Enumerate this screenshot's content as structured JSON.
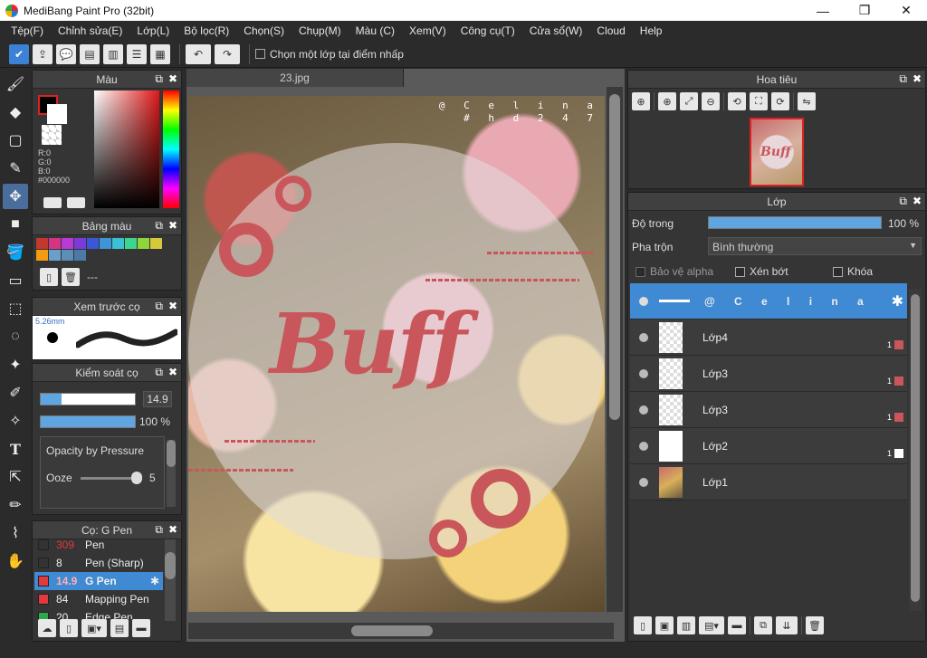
{
  "window": {
    "title": "MediBang Paint Pro (32bit)",
    "minimize": "—",
    "maximize": "❐",
    "close": "✕"
  },
  "menu": [
    "Tệp(F)",
    "Chỉnh sửa(E)",
    "Lớp(L)",
    "Bộ lọc(R)",
    "Chọn(S)",
    "Chụp(M)",
    "Màu (C)",
    "Xem(V)",
    "Công cụ(T)",
    "Cửa sổ(W)",
    "Cloud",
    "Help"
  ],
  "toolbar": {
    "select_one_layer_label": "Chọn một lớp tại điểm nhấp"
  },
  "color_panel": {
    "title": "Màu",
    "r": "R:0",
    "g": "G:0",
    "b": "B:0",
    "hex": "#000000"
  },
  "palette_panel": {
    "title": "Bảng màu",
    "name": "---",
    "swatches": [
      "#c0392b",
      "#d63384",
      "#b83bd6",
      "#7a3bd6",
      "#3b56d6",
      "#3b95d6",
      "#3bc0d6",
      "#3bd68f",
      "#8fd63b",
      "#d6c83b",
      "#f39c12",
      "#6aa0c8",
      "#5c8fb8",
      "#4a7aa5"
    ]
  },
  "brush_preview": {
    "title": "Xem trước cọ",
    "size": "5.26mm"
  },
  "brush_control": {
    "title": "Kiểm soát cọ",
    "size_value": "14.9",
    "opacity_value": "100 %",
    "size_fraction": 0.22,
    "opacity_fraction": 1.0,
    "pressure_label": "Opacity by Pressure",
    "ooze_label": "Ooze",
    "ooze_value": "5"
  },
  "brush_list": {
    "title": "Cọ: G Pen",
    "items": [
      {
        "size": "309",
        "name": "Pen",
        "color": "#333333"
      },
      {
        "size": "8",
        "name": "Pen (Sharp)",
        "color": "#333333"
      },
      {
        "size": "14.9",
        "name": "G Pen",
        "color": "#e0393e",
        "selected": true
      },
      {
        "size": "84",
        "name": "Mapping Pen",
        "color": "#e0393e"
      },
      {
        "size": "20",
        "name": "Edge Pen",
        "color": "#2ba84a"
      }
    ]
  },
  "document": {
    "tab": "23.jpg",
    "signature": "@ C e l i n a\n# h d 2 4 7",
    "headline": "Buff"
  },
  "navigator": {
    "title": "Hoa tiêu"
  },
  "layers_panel": {
    "title": "Lớp",
    "opacity_label": "Độ trong",
    "opacity_value": "100 %",
    "opacity_fraction": 1.0,
    "blend_label": "Pha trộn",
    "blend_value": "Bình thường",
    "protect_alpha": "Bảo vệ alpha",
    "clipping": "Xén bớt",
    "lock": "Khóa",
    "layers": [
      {
        "name": "@ C e l i n a",
        "selected": true
      },
      {
        "name": "Lớp4",
        "opacity": "1",
        "swatch": "#c9565a"
      },
      {
        "name": "Lớp3",
        "opacity": "1",
        "swatch": "#c9565a"
      },
      {
        "name": "Lớp3",
        "opacity": "1",
        "swatch": "#c9565a"
      },
      {
        "name": "Lớp2",
        "opacity": "1",
        "swatch": "#ffffff"
      },
      {
        "name": "Lớp1"
      }
    ]
  }
}
